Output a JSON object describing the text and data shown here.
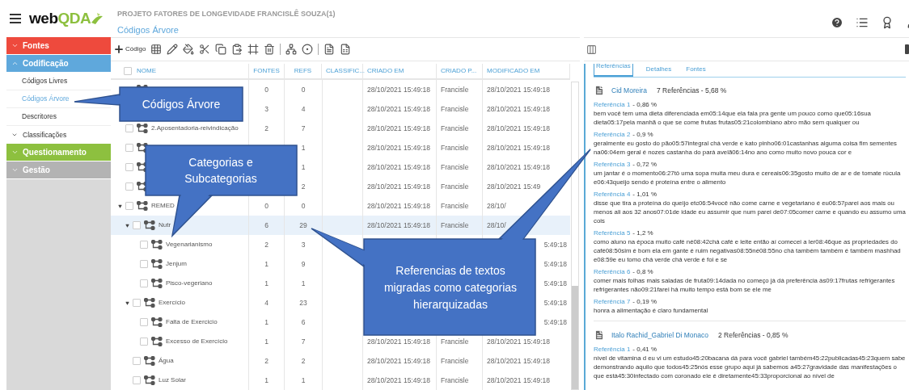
{
  "logo": {
    "part1": "web",
    "part2": "QDA"
  },
  "nav": [
    {
      "label": "Fontes",
      "kind": "section",
      "expanded": false,
      "color": "#ee4a3d"
    },
    {
      "label": "Codificação",
      "kind": "section",
      "expanded": true,
      "color": "#5fa8dc"
    },
    {
      "label": "Códigos Livres",
      "kind": "item",
      "selected": false
    },
    {
      "label": "Códigos Árvore",
      "kind": "item",
      "selected": true
    },
    {
      "label": "Descritores",
      "kind": "item",
      "selected": false
    },
    {
      "label": "Classificações",
      "kind": "group",
      "selected": false
    },
    {
      "label": "Questionamento",
      "kind": "section",
      "expanded": false,
      "color": "#8dc03f"
    },
    {
      "label": "Gestão",
      "kind": "section",
      "expanded": false,
      "color": "#b3b3b3"
    }
  ],
  "header": {
    "project": "PROJETO FATORES DE LONGEVIDADE FRANCISLÊ SOUZA(1)",
    "page": "Códigos Árvore"
  },
  "toolbar": {
    "new_label": "Código"
  },
  "table": {
    "header_checked": false,
    "columns": [
      "NOME",
      "FONTES",
      "REFS",
      "CLASSIFIC...",
      "CRIADO EM",
      "CRIADO P...",
      "MODIFICADO EM"
    ],
    "rows": [
      {
        "selected": false,
        "fontes": "0",
        "refs": "0",
        "criado_em": "28/10/2021 15:49:18",
        "criado_por": "Francisle",
        "modificado_em": "28/10/2021 15:49:18"
      },
      {
        "selected": false,
        "fontes": "3",
        "refs": "4",
        "criado_em": "28/10/2021 15:49:18",
        "criado_por": "Francisle",
        "modificado_em": "28/10/2021 15:49:18"
      },
      {
        "name": "2.Aposentadoria-reivindicação",
        "checked": false,
        "selected": false,
        "fontes": "2",
        "refs": "7",
        "criado_em": "28/10/2021 15:49:18",
        "criado_por": "Francisle",
        "modificado_em": "28/10/2021 15:49:18"
      },
      {
        "checked": false,
        "selected": false,
        "refs": "1",
        "criado_em": "28/10/2021 15:49:18",
        "criado_por": "Francisle",
        "modificado_em": "28/10/2021 15:49:18"
      },
      {
        "checked": false,
        "selected": false,
        "refs": "1",
        "criado_em": "28/10/2021 15:49:18",
        "criado_por": "Francisle",
        "modificado_em": "28/10/2021 15:49:18"
      },
      {
        "checked": false,
        "selected": false,
        "refs": "2",
        "criado_em": "28/10/2021 15:49:18",
        "criado_por": "Francisle",
        "modificado_em": "28/10/2021 15:49"
      },
      {
        "name": "REMED",
        "checked": false,
        "selected": false,
        "expanded": true,
        "fontes": "0",
        "refs": "0",
        "criado_em": "28/10/2021 15:49:18",
        "criado_por": "Francisle",
        "modificado_em": "28/10/",
        "children": [
          {
            "name": "Nutr",
            "checked": false,
            "selected": true,
            "expanded": true,
            "fontes": "6",
            "refs": "29",
            "criado_em": "28/10/2021 15:49:18",
            "criado_por": "Francisle",
            "modificado_em": "28/10/",
            "children": [
              {
                "name": "Vegenarianismo",
                "checked": false,
                "selected": false,
                "fontes": "2",
                "refs": "3",
                "modificado_em": "5:49:18"
              },
              {
                "name": "Jenjum",
                "checked": false,
                "selected": false,
                "fontes": "1",
                "refs": "9",
                "modificado_em": "5:49:18"
              },
              {
                "name": "Pisco-vegeriano",
                "checked": false,
                "selected": false,
                "fontes": "1",
                "refs": "1",
                "modificado_em": "5:49:18"
              }
            ]
          },
          {
            "name": "Exercício",
            "checked": false,
            "selected": false,
            "expanded": true,
            "fontes": "4",
            "refs": "23",
            "modificado_em": "5:49:18",
            "children": [
              {
                "name": "Falta de Exercicio",
                "checked": false,
                "selected": false,
                "fontes": "1",
                "refs": "6",
                "modificado_em": "5:49:18"
              },
              {
                "name": "Excesso de Exercício",
                "checked": false,
                "selected": false,
                "fontes": "1",
                "refs": "7",
                "criado_em": "28/10/2021 15:49:18",
                "criado_por": "Francisle",
                "modificado_em": "28/10/2021 15:49:18"
              }
            ]
          },
          {
            "name": "Água",
            "checked": false,
            "selected": false,
            "fontes": "2",
            "refs": "2",
            "criado_em": "28/10/2021 15:49:18",
            "criado_por": "Francisle",
            "modificado_em": "28/10/2021 15:49:18"
          },
          {
            "name": "Luz Solar",
            "checked": false,
            "selected": false,
            "fontes": "1",
            "refs": "1",
            "criado_em": "28/10/2021 15:49:18",
            "criado_por": "Francisle",
            "modificado_em": "28/10/2021 15:49:18"
          }
        ]
      }
    ]
  },
  "panel": {
    "tabs": [
      {
        "label": "Referências",
        "selected": true
      },
      {
        "label": "Detalhes",
        "selected": false
      },
      {
        "label": "Fontes",
        "selected": false
      }
    ],
    "sources": [
      {
        "name": "Cid Moreira",
        "summary": "7 Referências - 5,68 %",
        "references": [
          {
            "label": "Referência 1",
            "percent": "- 0,86 %",
            "text": "bem você tem uma dieta diferenciada em05:14que ela fala pra gente um pouco como que05:16sua dieta05:17pela manhã o que se come frutas frutas05:21colombiano abro mão sem qualquer ou"
          },
          {
            "label": "Referência 2",
            "percent": "- 0,9 %",
            "text": "geralmente eu gosto do pão05:57integral chá verde e kato pinho06:01castanhas alguma coisa fim sementes na06:04em geral é nozes castanha do pará avelã06:14no ano como muito novo pouca cor e"
          },
          {
            "label": "Referência 3",
            "percent": "- 0,72 %",
            "text": "um jantar é o momento06:27tô uma sopa muita meu dura e cereais06:35gosto muito de ar e de tomate rúcula e06:43queijo sendo é proteína entre o alimento"
          },
          {
            "label": "Referência 4",
            "percent": "- 1,01 %",
            "text": "disse que tira a proteína do queijo etc06:54você não come carne e vegetariano é eu06:57parei aos mais ou menos ali aos 32 anos07:01de idade eu assumir que num parei de07:05comer carne e quando eu assumo uma cois"
          },
          {
            "label": "Referência 5",
            "percent": "- 1,2 %",
            "text": "como aluno na época muito café né08:42chá café e leite então aí comecei a ler08:46que as propriedades do café08:50sim é bom ela em gante é ruim negativas08:55né08:55no chá também também é também mashhad e08:59e eu tomo chá verde chá verde é foi e se"
          },
          {
            "label": "Referência 6",
            "percent": "- 0,8 %",
            "text": "comer mais folhas mais saladas de fruta09:14dada no começo já dá preferência às09:17frutas refrigerantes refrigerantes não09:21farei há muito tempo está bom se ele me"
          },
          {
            "label": "Referência 7",
            "percent": "- 0,19 %",
            "text": "honra a alimentação é claro fundamental"
          }
        ]
      },
      {
        "name": "Italo Rachid_Gabriel Di Monaco",
        "summary": "2 Referências - 0,85 %",
        "references": [
          {
            "label": "Referência 1",
            "percent": "- 0,41 %",
            "text": "nível de vitamina d eu vi um estudo45:20bacana dá para você gabriel também45:22publicadas45:23quem sabe demonstrando aquilo que todos45:25nós esse grupo aqui já sabemos a45:27gravidade das manifestações o que está45:30infectado com coronado ele é diretamente45:33proporcional ao nível de"
          }
        ]
      }
    ]
  },
  "callouts": [
    "Códigos Árvore",
    "Categorias e Subcategorias",
    "Referencias de textos migradas como categorias hierarquizadas"
  ]
}
